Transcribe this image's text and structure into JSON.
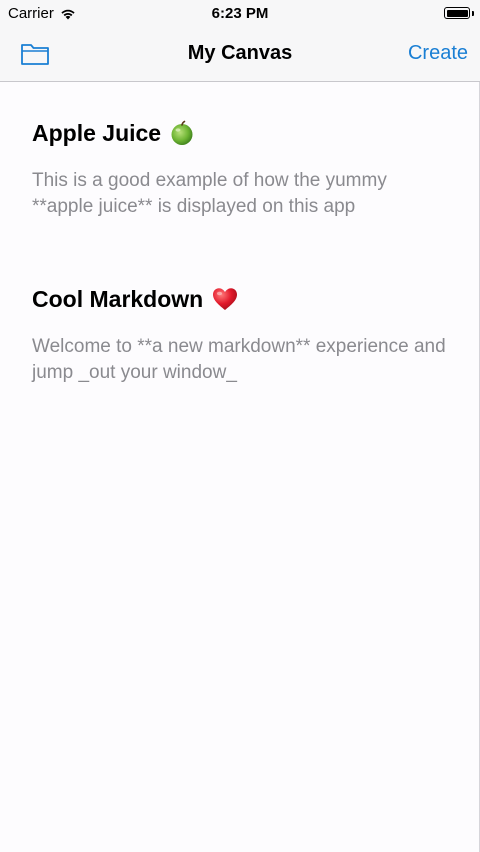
{
  "status_bar": {
    "carrier": "Carrier",
    "time": "6:23 PM",
    "wifi_icon": "wifi-icon",
    "battery_icon": "battery-icon"
  },
  "nav": {
    "folder_icon": "folder-icon",
    "title": "My Canvas",
    "create_label": "Create",
    "accent_color": "#1a7fd4"
  },
  "notes": [
    {
      "title": "Apple Juice",
      "emoji": "green-apple-icon",
      "body": "This is a good example of how the yummy **apple juice** is displayed on this app"
    },
    {
      "title": "Cool Markdown",
      "emoji": "red-heart-icon",
      "body": "Welcome to **a new markdown** experience and jump _out your window_"
    }
  ]
}
